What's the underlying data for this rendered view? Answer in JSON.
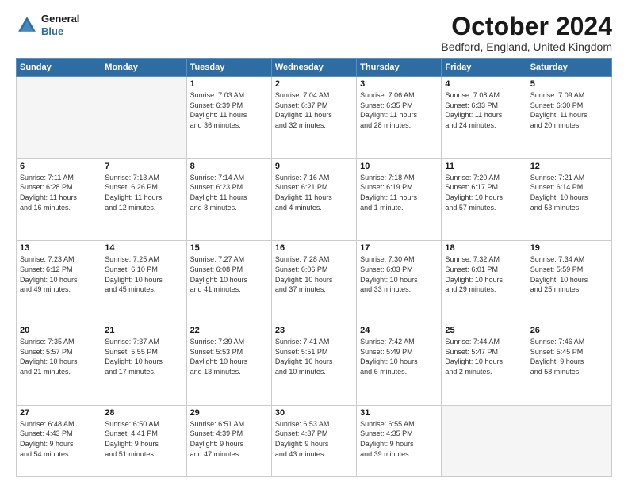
{
  "logo": {
    "line1": "General",
    "line2": "Blue"
  },
  "header": {
    "month": "October 2024",
    "location": "Bedford, England, United Kingdom"
  },
  "weekdays": [
    "Sunday",
    "Monday",
    "Tuesday",
    "Wednesday",
    "Thursday",
    "Friday",
    "Saturday"
  ],
  "weeks": [
    [
      {
        "day": "",
        "info": ""
      },
      {
        "day": "",
        "info": ""
      },
      {
        "day": "1",
        "info": "Sunrise: 7:03 AM\nSunset: 6:39 PM\nDaylight: 11 hours\nand 36 minutes."
      },
      {
        "day": "2",
        "info": "Sunrise: 7:04 AM\nSunset: 6:37 PM\nDaylight: 11 hours\nand 32 minutes."
      },
      {
        "day": "3",
        "info": "Sunrise: 7:06 AM\nSunset: 6:35 PM\nDaylight: 11 hours\nand 28 minutes."
      },
      {
        "day": "4",
        "info": "Sunrise: 7:08 AM\nSunset: 6:33 PM\nDaylight: 11 hours\nand 24 minutes."
      },
      {
        "day": "5",
        "info": "Sunrise: 7:09 AM\nSunset: 6:30 PM\nDaylight: 11 hours\nand 20 minutes."
      }
    ],
    [
      {
        "day": "6",
        "info": "Sunrise: 7:11 AM\nSunset: 6:28 PM\nDaylight: 11 hours\nand 16 minutes."
      },
      {
        "day": "7",
        "info": "Sunrise: 7:13 AM\nSunset: 6:26 PM\nDaylight: 11 hours\nand 12 minutes."
      },
      {
        "day": "8",
        "info": "Sunrise: 7:14 AM\nSunset: 6:23 PM\nDaylight: 11 hours\nand 8 minutes."
      },
      {
        "day": "9",
        "info": "Sunrise: 7:16 AM\nSunset: 6:21 PM\nDaylight: 11 hours\nand 4 minutes."
      },
      {
        "day": "10",
        "info": "Sunrise: 7:18 AM\nSunset: 6:19 PM\nDaylight: 11 hours\nand 1 minute."
      },
      {
        "day": "11",
        "info": "Sunrise: 7:20 AM\nSunset: 6:17 PM\nDaylight: 10 hours\nand 57 minutes."
      },
      {
        "day": "12",
        "info": "Sunrise: 7:21 AM\nSunset: 6:14 PM\nDaylight: 10 hours\nand 53 minutes."
      }
    ],
    [
      {
        "day": "13",
        "info": "Sunrise: 7:23 AM\nSunset: 6:12 PM\nDaylight: 10 hours\nand 49 minutes."
      },
      {
        "day": "14",
        "info": "Sunrise: 7:25 AM\nSunset: 6:10 PM\nDaylight: 10 hours\nand 45 minutes."
      },
      {
        "day": "15",
        "info": "Sunrise: 7:27 AM\nSunset: 6:08 PM\nDaylight: 10 hours\nand 41 minutes."
      },
      {
        "day": "16",
        "info": "Sunrise: 7:28 AM\nSunset: 6:06 PM\nDaylight: 10 hours\nand 37 minutes."
      },
      {
        "day": "17",
        "info": "Sunrise: 7:30 AM\nSunset: 6:03 PM\nDaylight: 10 hours\nand 33 minutes."
      },
      {
        "day": "18",
        "info": "Sunrise: 7:32 AM\nSunset: 6:01 PM\nDaylight: 10 hours\nand 29 minutes."
      },
      {
        "day": "19",
        "info": "Sunrise: 7:34 AM\nSunset: 5:59 PM\nDaylight: 10 hours\nand 25 minutes."
      }
    ],
    [
      {
        "day": "20",
        "info": "Sunrise: 7:35 AM\nSunset: 5:57 PM\nDaylight: 10 hours\nand 21 minutes."
      },
      {
        "day": "21",
        "info": "Sunrise: 7:37 AM\nSunset: 5:55 PM\nDaylight: 10 hours\nand 17 minutes."
      },
      {
        "day": "22",
        "info": "Sunrise: 7:39 AM\nSunset: 5:53 PM\nDaylight: 10 hours\nand 13 minutes."
      },
      {
        "day": "23",
        "info": "Sunrise: 7:41 AM\nSunset: 5:51 PM\nDaylight: 10 hours\nand 10 minutes."
      },
      {
        "day": "24",
        "info": "Sunrise: 7:42 AM\nSunset: 5:49 PM\nDaylight: 10 hours\nand 6 minutes."
      },
      {
        "day": "25",
        "info": "Sunrise: 7:44 AM\nSunset: 5:47 PM\nDaylight: 10 hours\nand 2 minutes."
      },
      {
        "day": "26",
        "info": "Sunrise: 7:46 AM\nSunset: 5:45 PM\nDaylight: 9 hours\nand 58 minutes."
      }
    ],
    [
      {
        "day": "27",
        "info": "Sunrise: 6:48 AM\nSunset: 4:43 PM\nDaylight: 9 hours\nand 54 minutes."
      },
      {
        "day": "28",
        "info": "Sunrise: 6:50 AM\nSunset: 4:41 PM\nDaylight: 9 hours\nand 51 minutes."
      },
      {
        "day": "29",
        "info": "Sunrise: 6:51 AM\nSunset: 4:39 PM\nDaylight: 9 hours\nand 47 minutes."
      },
      {
        "day": "30",
        "info": "Sunrise: 6:53 AM\nSunset: 4:37 PM\nDaylight: 9 hours\nand 43 minutes."
      },
      {
        "day": "31",
        "info": "Sunrise: 6:55 AM\nSunset: 4:35 PM\nDaylight: 9 hours\nand 39 minutes."
      },
      {
        "day": "",
        "info": ""
      },
      {
        "day": "",
        "info": ""
      }
    ]
  ]
}
